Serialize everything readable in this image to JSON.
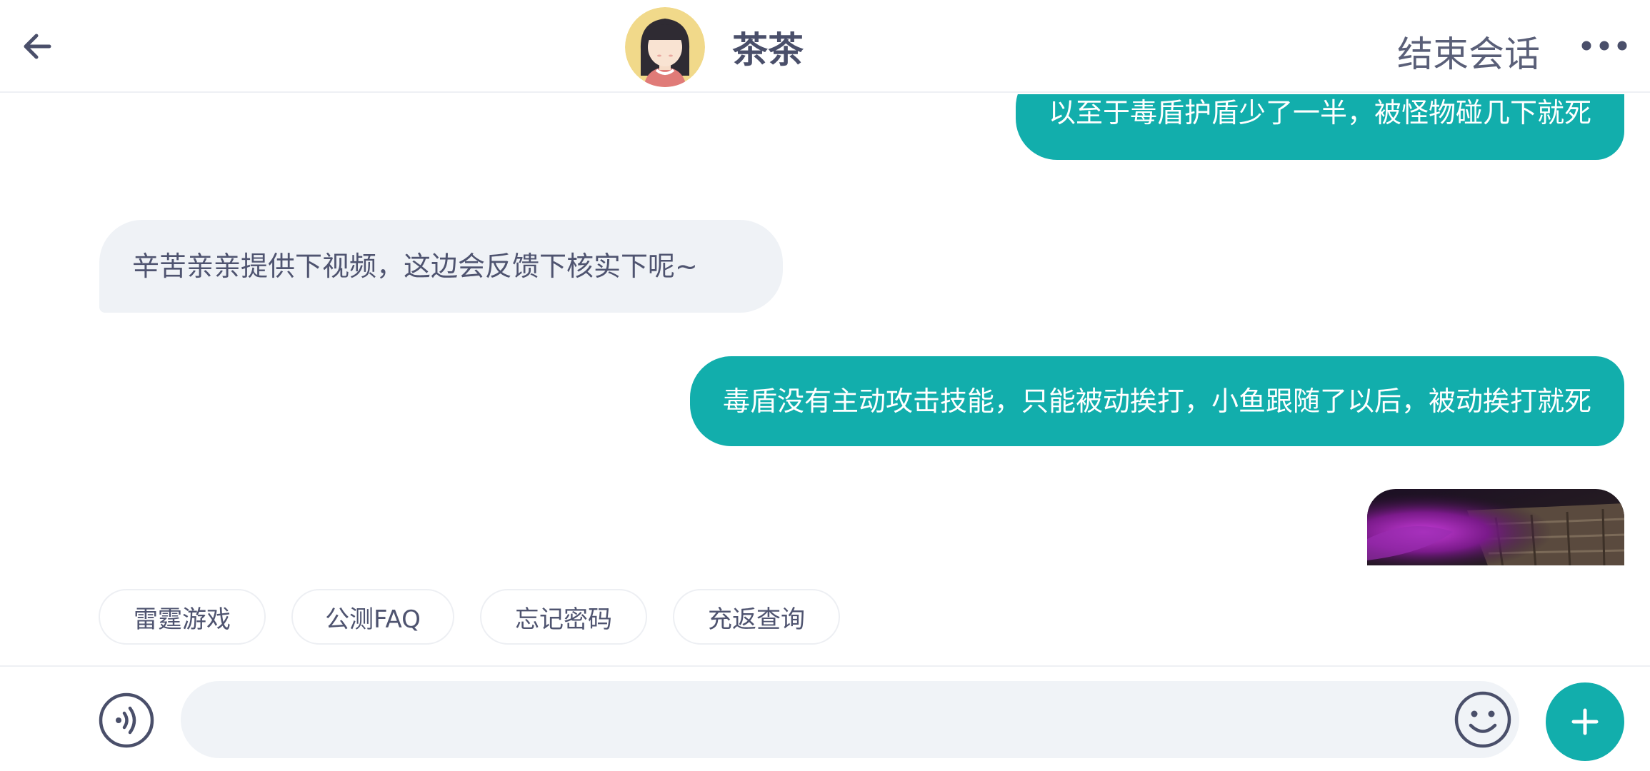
{
  "header": {
    "agent_name": "茶茶",
    "end_session_label": "结束会话"
  },
  "messages": [
    {
      "sender": "user",
      "text": "以至于毒盾护盾少了一半，被怪物碰几下就死"
    },
    {
      "sender": "agent",
      "text": "辛苦亲亲提供下视频，这边会反馈下核实下呢~"
    },
    {
      "sender": "user",
      "text": "毒盾没有主动攻击技能，只能被动挨打，小鱼跟随了以后，被动挨打就死"
    },
    {
      "sender": "user",
      "type": "image"
    }
  ],
  "quick_replies": [
    "雷霆游戏",
    "公测FAQ",
    "忘记密码",
    "充返查询"
  ],
  "input": {
    "value": "",
    "placeholder": ""
  },
  "colors": {
    "accent": "#12aeac",
    "agent_bubble": "#eff2f6",
    "text": "#4a4f6a"
  },
  "icons": [
    "back-arrow-icon",
    "avatar",
    "more-dots-icon",
    "voice-icon",
    "emoji-icon",
    "plus-icon"
  ]
}
